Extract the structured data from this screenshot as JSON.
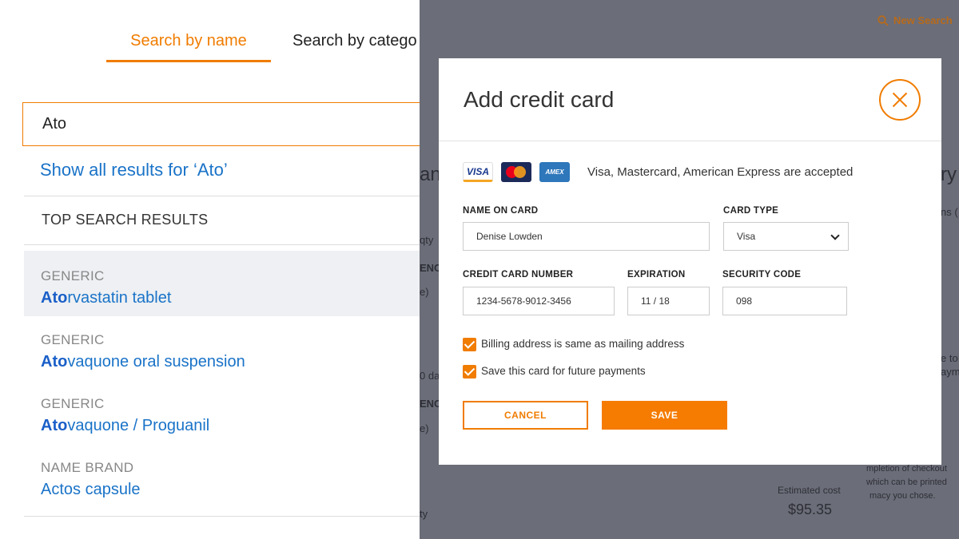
{
  "search_panel": {
    "tabs": [
      {
        "label": "Search by name"
      },
      {
        "label": "Search by catego"
      }
    ],
    "query": "Ato",
    "show_all_label": "Show all results for ‘Ato’",
    "top_results_heading": "TOP SEARCH RESULTS",
    "results": [
      {
        "category": "GENERIC",
        "match": "Ato",
        "rest": "rvastatin tablet"
      },
      {
        "category": "GENERIC",
        "match": "Ato",
        "rest": "vaquone oral suspension"
      },
      {
        "category": "GENERIC",
        "match": "Ato",
        "rest": "vaquone / Proguanil"
      },
      {
        "category": "NAME BRAND",
        "match": "",
        "rest": "Actos capsule"
      }
    ]
  },
  "background_page": {
    "new_search_label": "New Search",
    "estimated_cost_label": "Estimated cost",
    "estimated_cost_value": "$95.35",
    "fragments": [
      "an",
      "ry",
      "qty",
      "ENC",
      "e)",
      "ns (",
      "0 da",
      "ENC",
      "e)",
      "e to",
      "aym",
      "mpletion of checkout",
      "which can be printed",
      "macy you chose.",
      "ty"
    ]
  },
  "modal": {
    "title": "Add credit card",
    "card_logos": {
      "visa": "VISA",
      "amex": "AMEX",
      "mastercard_icon": "mastercard-icon"
    },
    "accepted_text": "Visa, Mastercard, American Express are accepted",
    "name_label": "NAME ON CARD",
    "name_value": "Denise Lowden",
    "card_type_label": "CARD TYPE",
    "card_type_value": "Visa",
    "number_label": "CREDIT CARD NUMBER",
    "number_value": "1234-5678-9012-3456",
    "expiration_label": "EXPIRATION",
    "expiration_value": "11 / 18",
    "security_label": "SECURITY CODE",
    "security_value": "098",
    "checkboxes": [
      {
        "label": "Billing address is same as mailing address",
        "checked": true
      },
      {
        "label": "Save this card for future payments",
        "checked": true
      }
    ],
    "cancel_label": "CANCEL",
    "save_label": "SAVE"
  },
  "colors": {
    "accent": "#f07c00",
    "link": "#1a73c8",
    "overlay": "#6b6d78"
  }
}
